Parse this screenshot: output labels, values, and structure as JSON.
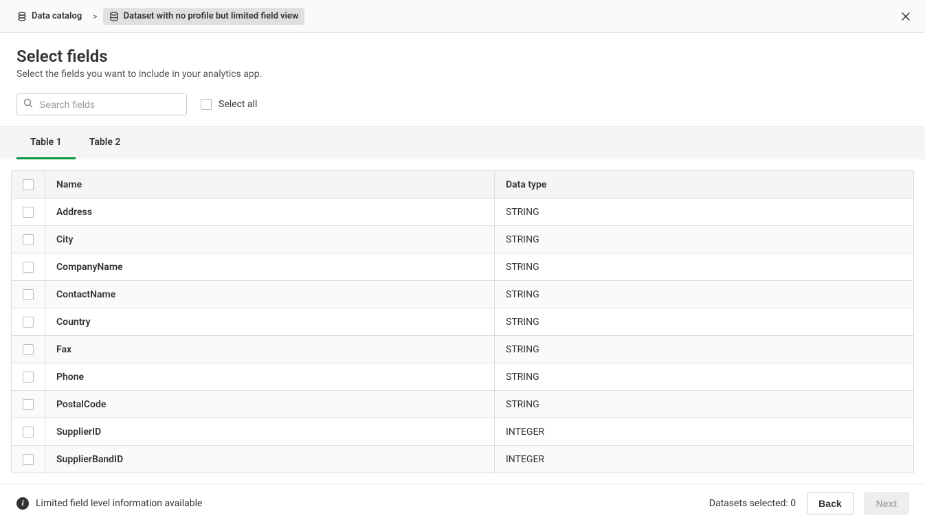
{
  "breadcrumb": {
    "root_label": "Data catalog",
    "separator": ">",
    "current_label": "Dataset with no profile but limited field view"
  },
  "header": {
    "title": "Select fields",
    "subtitle": "Select the fields you want to include in your analytics app."
  },
  "search": {
    "placeholder": "Search fields"
  },
  "select_all_label": "Select all",
  "tabs": [
    {
      "label": "Table 1",
      "active": true
    },
    {
      "label": "Table 2",
      "active": false
    }
  ],
  "table": {
    "columns": {
      "name": "Name",
      "datatype": "Data type"
    },
    "rows": [
      {
        "name": "Address",
        "datatype": "STRING"
      },
      {
        "name": "City",
        "datatype": "STRING"
      },
      {
        "name": "CompanyName",
        "datatype": "STRING"
      },
      {
        "name": "ContactName",
        "datatype": "STRING"
      },
      {
        "name": "Country",
        "datatype": "STRING"
      },
      {
        "name": "Fax",
        "datatype": "STRING"
      },
      {
        "name": "Phone",
        "datatype": "STRING"
      },
      {
        "name": "PostalCode",
        "datatype": "STRING"
      },
      {
        "name": "SupplierID",
        "datatype": "INTEGER"
      },
      {
        "name": "SupplierBandID",
        "datatype": "INTEGER"
      }
    ]
  },
  "footer": {
    "info_message": "Limited field level information available",
    "datasets_selected_label": "Datasets selected: ",
    "datasets_selected_count": "0",
    "back_label": "Back",
    "next_label": "Next"
  }
}
